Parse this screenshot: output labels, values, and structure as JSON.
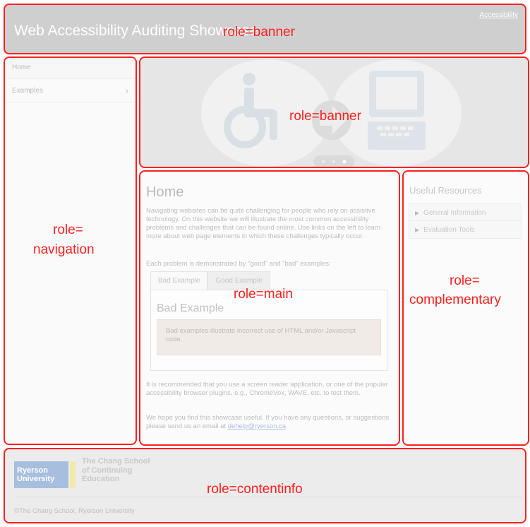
{
  "header": {
    "site_title": "Web Accessibility Auditing Showcase",
    "accessibility_link": "Accessibility",
    "role_label": "role=banner"
  },
  "nav": {
    "items": [
      {
        "label": "Home"
      },
      {
        "label": "Examples"
      }
    ],
    "role_label_line1": "role=",
    "role_label_line2": "navigation"
  },
  "carousel": {
    "role_label": "role=banner",
    "icons": [
      "wheelchair-icon",
      "arrow-right-icon",
      "computer-icon"
    ],
    "indicators": {
      "count": 3,
      "active_index": 2
    }
  },
  "main": {
    "title": "Home",
    "intro": "Navigating websites can be quite challenging for people who rely on assistive technology. On this website we will illustrate the most common accessibility problems and challenges that can be found online. Use links on the left to learn more about web page elements in which these challenges typically occur.",
    "each_problem": "Each problem is demonstrated by \"good\" and \"bad\" examples:",
    "tabs": [
      {
        "label": "Bad Example"
      },
      {
        "label": "Good Example"
      }
    ],
    "panel_title": "Bad Example",
    "panel_text": "Bad examples illustrate incorrect use of HTML and/or Javascript code.",
    "recommend": "It is recommended that you use a screen reader application, or one of the popular accessibility browser plugins, e.g., ChromeVox, WAVE, etc. to test them.",
    "closing_text": "We hope you find this showcase useful. If you have any questions, or suggestions please send us an email at",
    "email": "dehelp@ryerson.ca",
    "role_label": "role=main"
  },
  "aside": {
    "title": "Useful Resources",
    "items": [
      {
        "label": "General Information"
      },
      {
        "label": "Evaluation Tools"
      }
    ],
    "role_label_line1": "role=",
    "role_label_line2": "complementary"
  },
  "footer": {
    "logo_university": "Ryerson University",
    "logo_school_line1": "The Chang School",
    "logo_school_line2": "of Continuing",
    "logo_school_line3": "Education",
    "copyright": "©The Chang School, Ryerson University",
    "role_label": "role=contentinfo"
  },
  "colors": {
    "annotation_red": "#ff1f1f",
    "header_bg": "#cfcfcf",
    "logo_blue": "#a8bedf",
    "logo_yellow": "#f3e9a8"
  }
}
